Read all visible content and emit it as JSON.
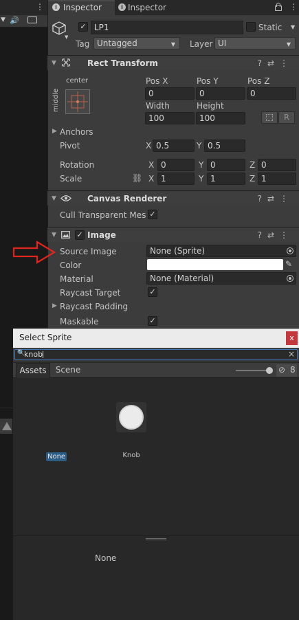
{
  "tabs": [
    {
      "label": "Inspector"
    },
    {
      "label": "Inspector"
    }
  ],
  "header": {
    "name": "LP1",
    "static_label": "Static",
    "tag_label": "Tag",
    "tag_value": "Untagged",
    "layer_label": "Layer",
    "layer_value": "UI"
  },
  "rect_transform": {
    "title": "Rect Transform",
    "anchor_h": "center",
    "anchor_v": "middle",
    "pos_x_label": "Pos X",
    "pos_y_label": "Pos Y",
    "pos_z_label": "Pos Z",
    "pos_x": "0",
    "pos_y": "0",
    "pos_z": "0",
    "width_label": "Width",
    "height_label": "Height",
    "width": "100",
    "height": "100",
    "r_button": "R",
    "anchors_label": "Anchors",
    "pivot_label": "Pivot",
    "pivot_x": "0.5",
    "pivot_y": "0.5",
    "rotation_label": "Rotation",
    "rot_x": "0",
    "rot_y": "0",
    "rot_z": "0",
    "scale_label": "Scale",
    "scale_x": "1",
    "scale_y": "1",
    "scale_z": "1",
    "axis_x": "X",
    "axis_y": "Y",
    "axis_z": "Z"
  },
  "canvas_renderer": {
    "title": "Canvas Renderer",
    "cull_label": "Cull Transparent Mesh"
  },
  "image": {
    "title": "Image",
    "source_image_label": "Source Image",
    "source_image_value": "None (Sprite)",
    "color_label": "Color",
    "material_label": "Material",
    "material_value": "None (Material)",
    "raycast_target_label": "Raycast Target",
    "raycast_padding_label": "Raycast Padding",
    "maskable_label": "Maskable"
  },
  "dialog": {
    "title": "Select Sprite",
    "close": "x",
    "search_value": "knob",
    "search_clear": "×",
    "tab_assets": "Assets",
    "tab_scene": "Scene",
    "hidden_count": "8",
    "items": [
      {
        "label": "None"
      },
      {
        "label": "Knob"
      }
    ],
    "preview_text": "None"
  },
  "colors": {
    "accent": "#2c5d87",
    "arrow": "#e0251f",
    "close_button": "#c4373b"
  }
}
